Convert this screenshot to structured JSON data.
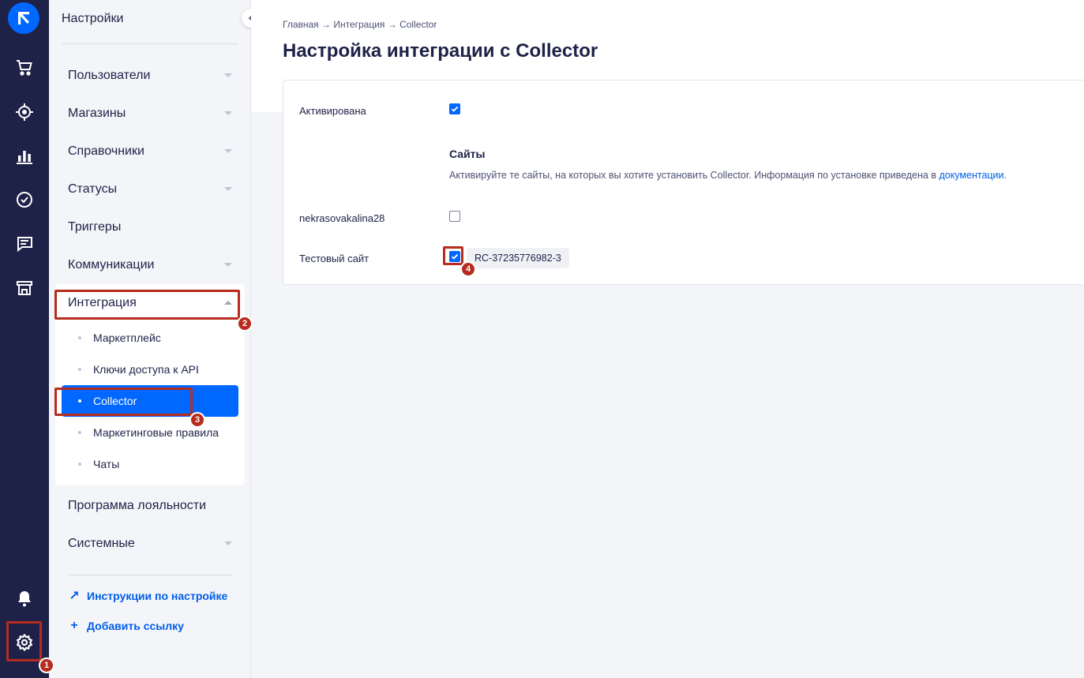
{
  "sidebar": {
    "title": "Настройки",
    "items": [
      {
        "label": "Пользователи"
      },
      {
        "label": "Магазины"
      },
      {
        "label": "Справочники"
      },
      {
        "label": "Статусы"
      },
      {
        "label": "Триггеры"
      },
      {
        "label": "Коммуникации"
      },
      {
        "label": "Интеграция"
      },
      {
        "label": "Программа лояльности"
      },
      {
        "label": "Системные"
      }
    ],
    "sub_items": [
      {
        "label": "Маркетплейс"
      },
      {
        "label": "Ключи доступа к API"
      },
      {
        "label": "Collector"
      },
      {
        "label": "Маркетинговые правила"
      },
      {
        "label": "Чаты"
      }
    ],
    "links": [
      {
        "label": "Инструкции по настройке"
      },
      {
        "label": "Добавить ссылку"
      }
    ]
  },
  "main": {
    "breadcrumb": "Главная → Интеграция → Collector",
    "title": "Настройка интеграции с Collector",
    "activated_label": "Активирована",
    "activated": true,
    "sites_title": "Сайты",
    "sites_hint": "Активируйте те сайты, на которых вы хотите установить Collector. Информация по установке приведена в ",
    "sites_hint_link": "документации",
    "sites_hint_end": ".",
    "sites": [
      {
        "name": "nekrasovakalina28",
        "enabled": false,
        "code": ""
      },
      {
        "name": "Тестовый сайт",
        "enabled": true,
        "code": "RC-37235776982-3"
      }
    ]
  },
  "annotations": [
    "1",
    "2",
    "3",
    "4"
  ],
  "colors": {
    "rail": "#1e2248",
    "accent": "#0068ff",
    "annotation": "#b62c1e"
  }
}
